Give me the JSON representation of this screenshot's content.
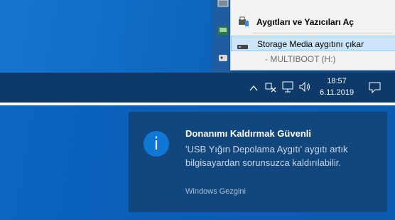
{
  "context_menu": {
    "open_devices_label": "Aygıtları ve Yazıcıları Aç",
    "eject_label": "Storage Media aygıtını çıkar",
    "drive_label": "- MULTIBOOT (H:)"
  },
  "taskbar": {
    "time": "18:57",
    "date": "6.11.2019",
    "icons": [
      "chevron-up-icon",
      "usb-error-icon",
      "network-icon",
      "volume-icon",
      "notification-icon"
    ]
  },
  "toast": {
    "title": "Donanımı Kaldırmak Güvenli",
    "body": "'USB Yığın Depolama Aygıtı' aygıtı artık bilgisayardan sorunsuzca kaldırılabilir.",
    "app_name": "Windows Gezgini"
  },
  "colors": {
    "taskbar": "#0d3a68",
    "toast_bg": "#12477d",
    "menu_highlight": "#cce4f7",
    "info_icon": "#0f78d4"
  }
}
